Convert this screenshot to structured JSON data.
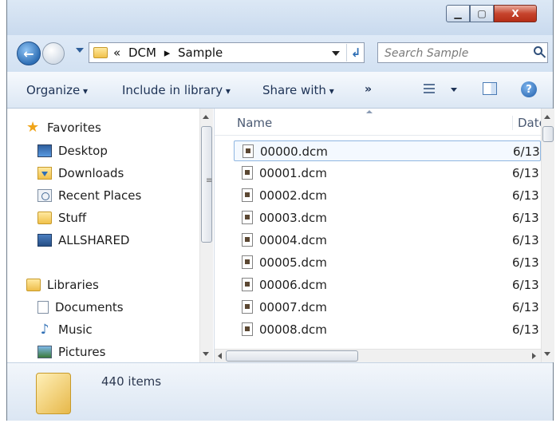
{
  "window": {
    "minimize_glyph": "▁",
    "maximize_glyph": "▢",
    "close_glyph": "X"
  },
  "address": {
    "overflow": "«",
    "path": [
      "DCM",
      "Sample"
    ],
    "separator": "▸",
    "refresh_glyph": "↲"
  },
  "search": {
    "placeholder": "Search Sample"
  },
  "toolbar": {
    "organize": "Organize",
    "include_in_library": "Include in library",
    "share_with": "Share with",
    "more": "»",
    "help": "?"
  },
  "navigation": {
    "favorites": {
      "label": "Favorites",
      "items": [
        {
          "label": "Desktop",
          "icon": "desktop-icon"
        },
        {
          "label": "Downloads",
          "icon": "downloads-icon"
        },
        {
          "label": "Recent Places",
          "icon": "recent-places-icon"
        },
        {
          "label": "Stuff",
          "icon": "folder-icon"
        },
        {
          "label": "ALLSHARED",
          "icon": "network-drive-icon"
        }
      ]
    },
    "libraries": {
      "label": "Libraries",
      "items": [
        {
          "label": "Documents",
          "icon": "documents-icon"
        },
        {
          "label": "Music",
          "icon": "music-icon"
        },
        {
          "label": "Pictures",
          "icon": "pictures-icon"
        }
      ]
    }
  },
  "files": {
    "columns": {
      "name": "Name",
      "date": "Date"
    },
    "rows": [
      {
        "name": "00000.dcm",
        "date": "6/13"
      },
      {
        "name": "00001.dcm",
        "date": "6/13"
      },
      {
        "name": "00002.dcm",
        "date": "6/13"
      },
      {
        "name": "00003.dcm",
        "date": "6/13"
      },
      {
        "name": "00004.dcm",
        "date": "6/13"
      },
      {
        "name": "00005.dcm",
        "date": "6/13"
      },
      {
        "name": "00006.dcm",
        "date": "6/13"
      },
      {
        "name": "00007.dcm",
        "date": "6/13"
      },
      {
        "name": "00008.dcm",
        "date": "6/13"
      }
    ],
    "selected_index": 0
  },
  "status": {
    "item_count": "440 items"
  },
  "colors": {
    "chrome": "#dfe9f5",
    "accent": "#2f6fb5",
    "close_button": "#c6442d",
    "selection_border": "#8fb6e1"
  }
}
